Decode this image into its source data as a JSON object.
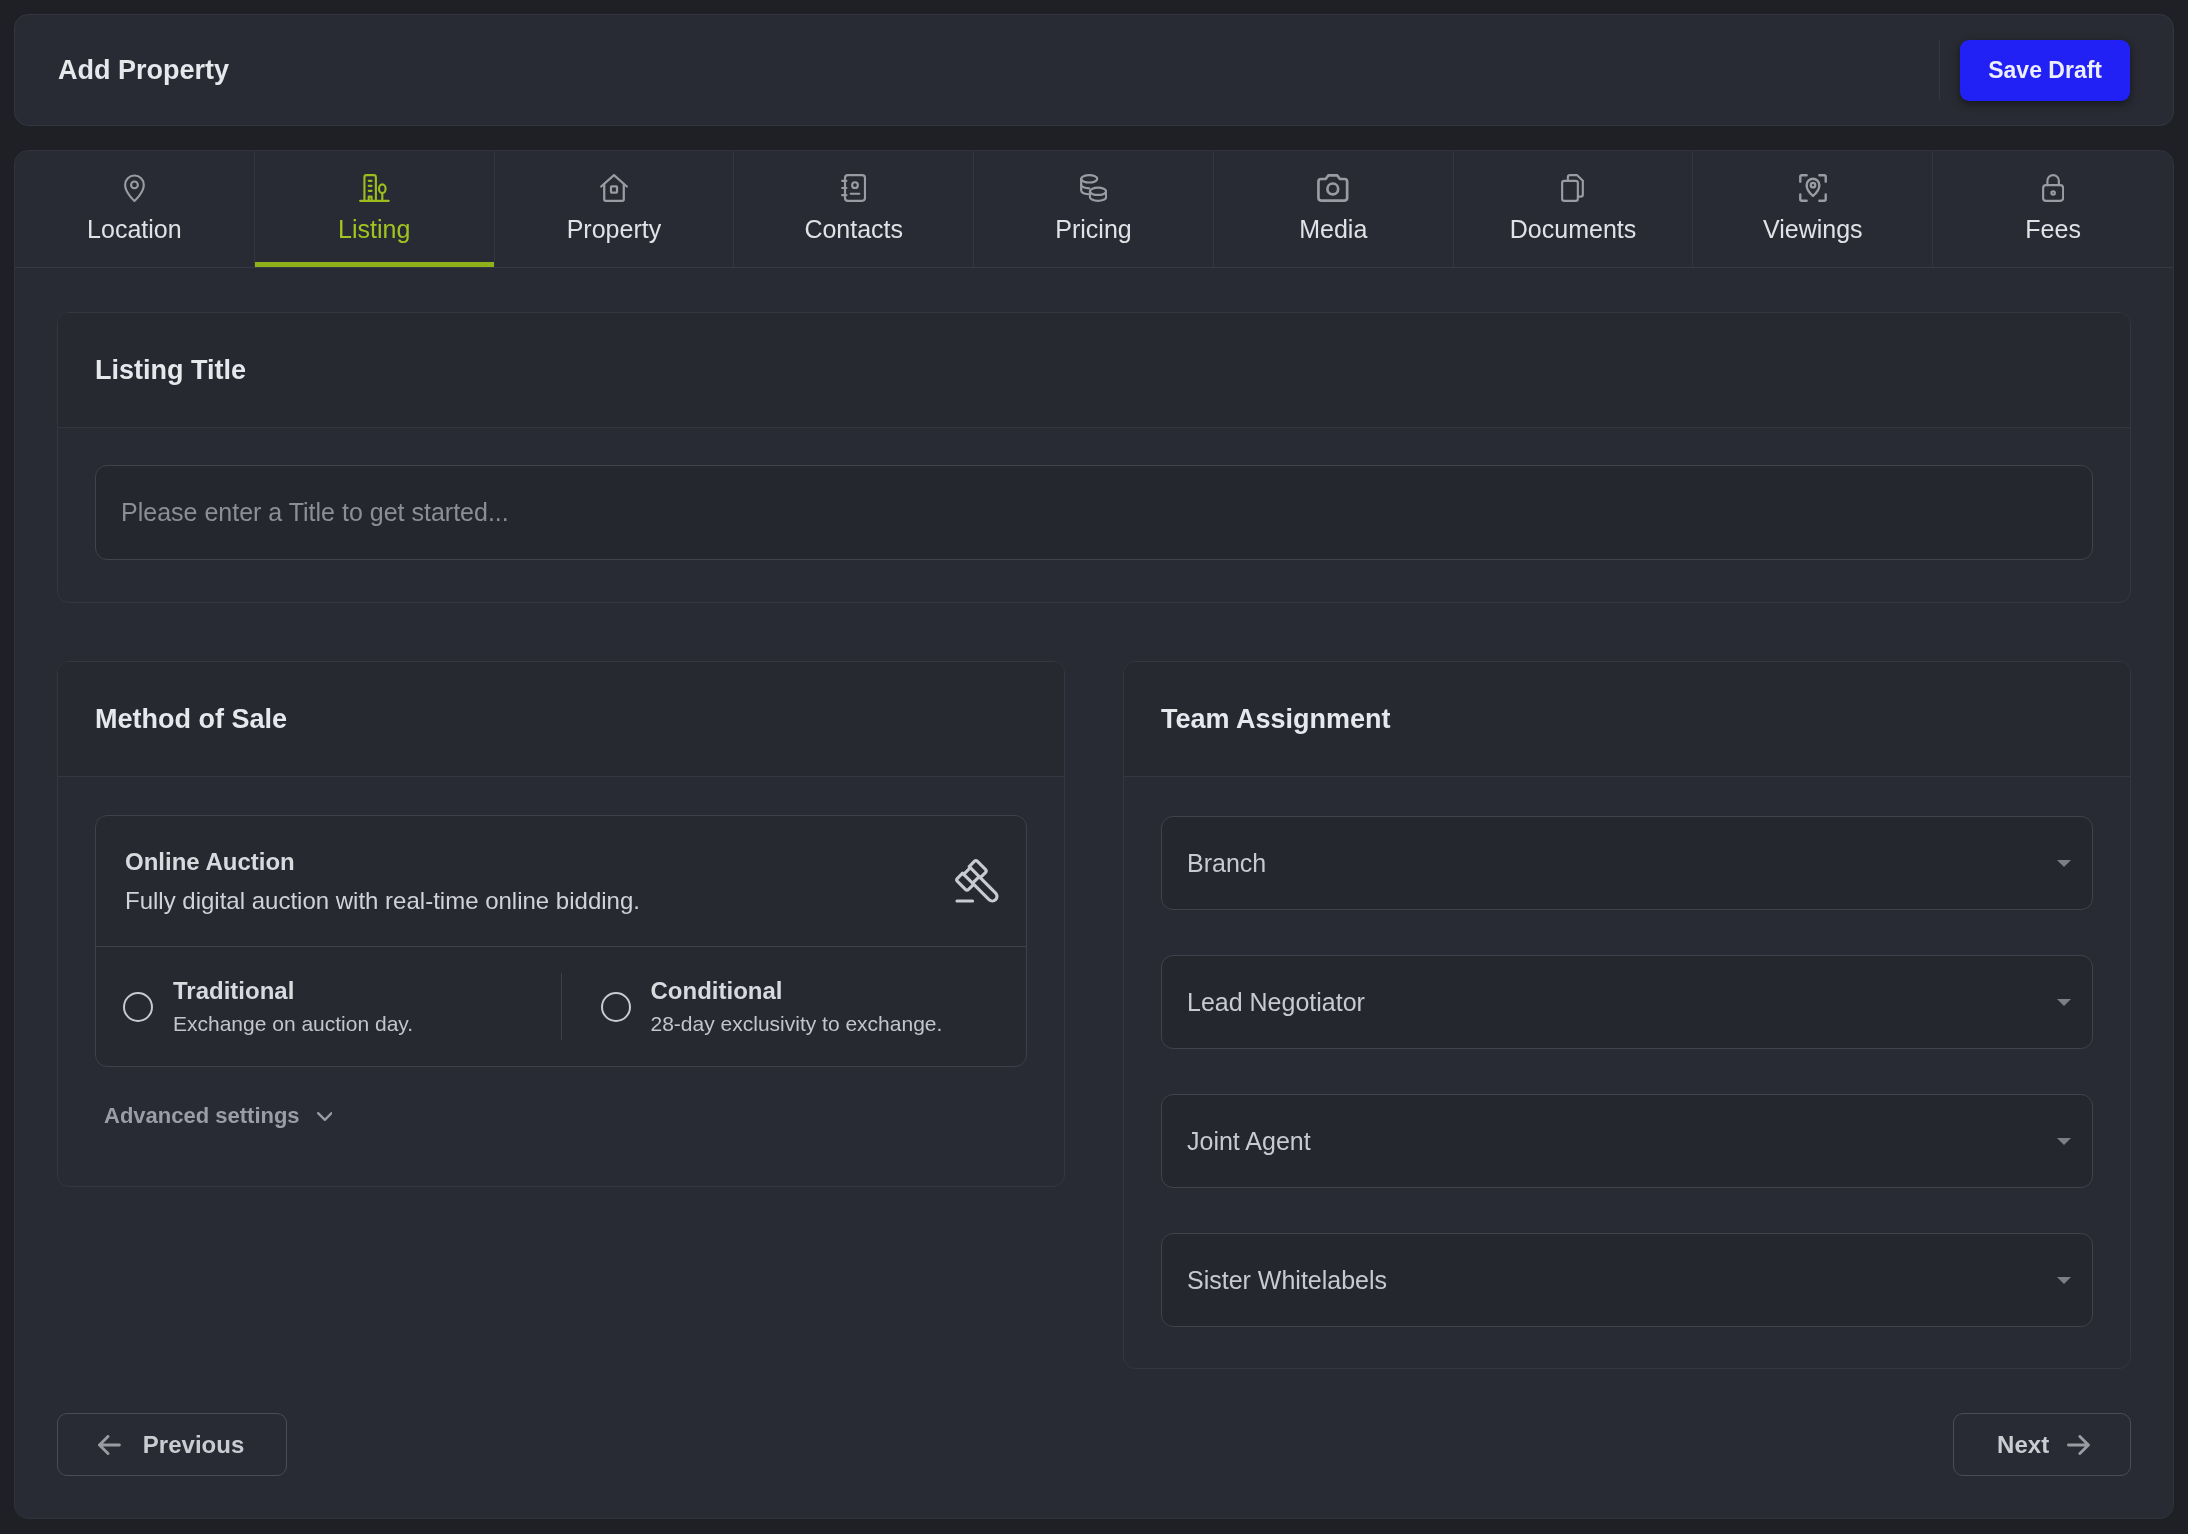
{
  "header": {
    "title": "Add Property",
    "save_button": "Save Draft"
  },
  "tabs": [
    {
      "label": "Location",
      "selected": false
    },
    {
      "label": "Listing",
      "selected": true
    },
    {
      "label": "Property",
      "selected": false
    },
    {
      "label": "Contacts",
      "selected": false
    },
    {
      "label": "Pricing",
      "selected": false
    },
    {
      "label": "Media",
      "selected": false
    },
    {
      "label": "Documents",
      "selected": false
    },
    {
      "label": "Viewings",
      "selected": false
    },
    {
      "label": "Fees",
      "selected": false
    }
  ],
  "listing_title": {
    "title": "Listing Title",
    "title_input": {
      "placeholder": "Please enter a Title to get started..."
    }
  },
  "method_of_sale": {
    "title": "Method of Sale",
    "online_auction": {
      "title": "Online Auction",
      "description": "Fully digital auction with real-time online bidding.",
      "options": [
        {
          "label": "Traditional",
          "description": "Exchange on auction day.",
          "selected": false
        },
        {
          "label": "Conditional",
          "description": "28-day exclusivity to exchange.",
          "selected": false
        }
      ]
    },
    "advanced_settings": {
      "label": "Advanced settings",
      "expanded": false
    }
  },
  "team_assignment": {
    "title": "Team Assignment",
    "fields": [
      {
        "label": "Branch"
      },
      {
        "label": "Lead Negotiator"
      },
      {
        "label": "Joint Agent"
      },
      {
        "label": "Sister Whitelabels"
      }
    ]
  },
  "footer": {
    "previous_button": "Previous",
    "next_button": "Next"
  }
}
